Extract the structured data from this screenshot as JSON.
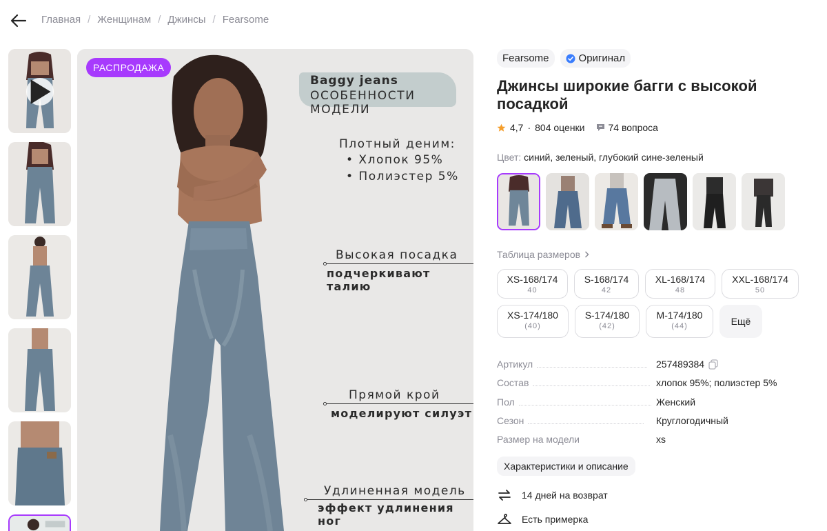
{
  "breadcrumb": [
    "Главная",
    "Женщинам",
    "Джинсы",
    "Fearsome"
  ],
  "icons": {
    "back": "arrow-left-icon",
    "play": "play-icon",
    "verified": "verified-check-icon",
    "star": "star-icon",
    "question": "question-bubble-icon",
    "chevron": "chevron-right-icon",
    "copy": "copy-icon",
    "return": "return-arrows-icon",
    "hanger": "hanger-icon"
  },
  "gallery": {
    "sale_badge": "РАСПРОДАЖА",
    "overlay": {
      "title_line1": "Baggy jeans",
      "title_line2": "ОСОБЕННОСТИ МОДЕЛИ",
      "fabric_title": "Плотный деним:",
      "fabric_bullets": [
        "• Хлопок 95%",
        "• Полиэстер 5%"
      ],
      "rise_title": "Высокая посадка",
      "rise_sub": "подчеркивают талию",
      "cut_title": "Прямой крой",
      "cut_sub": "моделируют силуэт",
      "length_title": "Удлиненная модель",
      "length_sub": "эффект удлинения ног"
    }
  },
  "product": {
    "brand": "Fearsome",
    "original_label": "Оригинал",
    "title": "Джинсы широкие багги с высокой посадкой",
    "rating": "4,7",
    "rating_sep": "·",
    "reviews": "804 оценки",
    "questions": "74 вопроса",
    "color_label": "Цвет:",
    "color_value": "синий, зеленый, глубокий сине-зеленый",
    "size_table_label": "Таблица размеров",
    "sizes": [
      {
        "label": "XS-168/174",
        "ru": "40"
      },
      {
        "label": "S-168/174",
        "ru": "42"
      },
      {
        "label": "XL-168/174",
        "ru": "48"
      },
      {
        "label": "XXL-168/174",
        "ru": "50"
      },
      {
        "label": "XS-174/180",
        "ru": "(40)"
      },
      {
        "label": "S-174/180",
        "ru": "(42)"
      },
      {
        "label": "M-174/180",
        "ru": "(44)"
      }
    ],
    "more_label": "Ещё",
    "specs": [
      {
        "key": "Артикул",
        "value": "257489384"
      },
      {
        "key": "Состав",
        "value": "хлопок 95%; полиэстер 5%"
      },
      {
        "key": "Пол",
        "value": "Женский"
      },
      {
        "key": "Сезон",
        "value": "Круглогодичный"
      },
      {
        "key": "Размер на модели",
        "value": "xs"
      }
    ],
    "chars_button": "Характеристики и описание",
    "perks": [
      "14 дней на возврат",
      "Есть примерка"
    ]
  },
  "colors": {
    "accent": "#a73afd",
    "star": "#f59e2b",
    "verified": "#3a7dfd",
    "muted": "#8b8b95"
  }
}
